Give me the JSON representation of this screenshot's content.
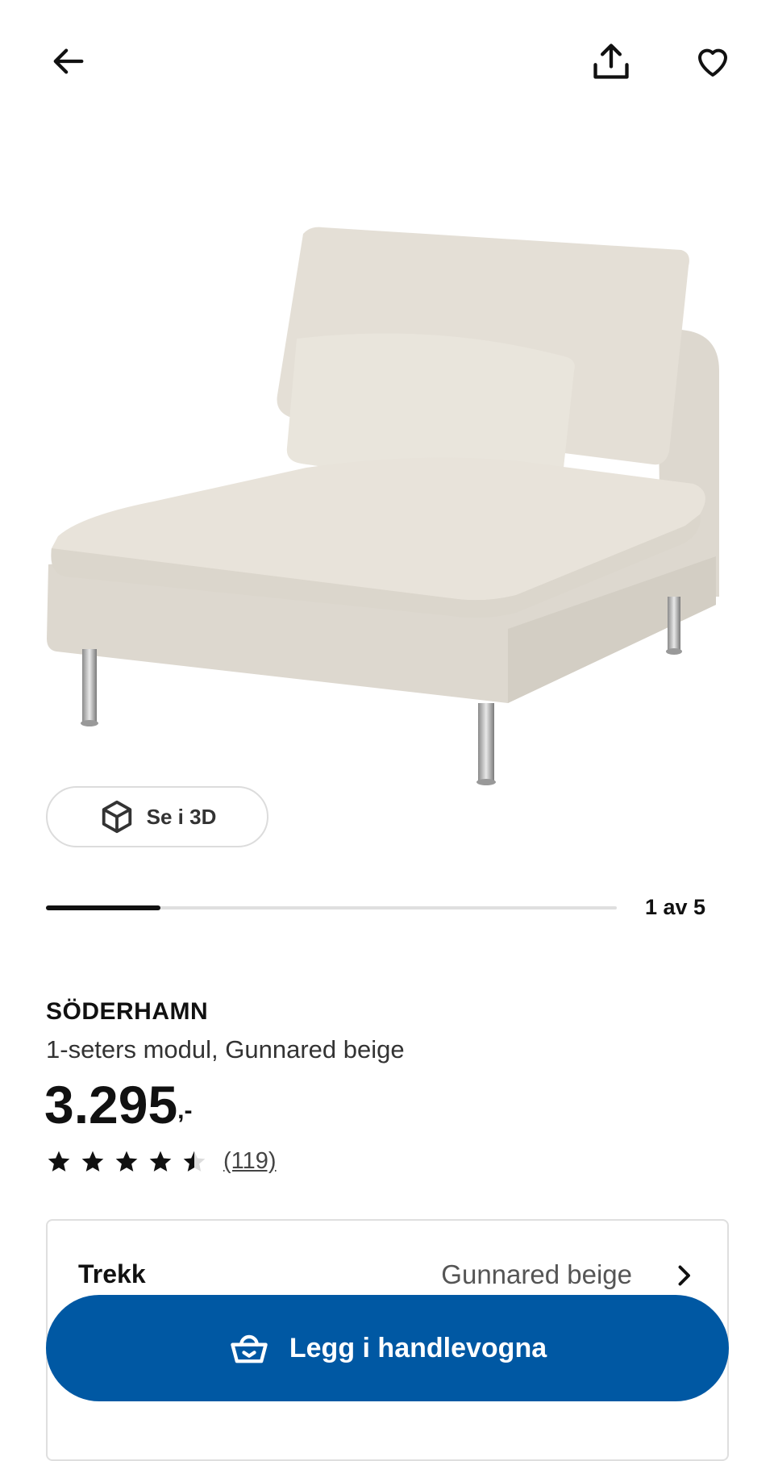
{
  "header": {
    "back_icon": "arrow-left-icon",
    "share_icon": "share-upload-icon",
    "favorite_icon": "heart-outline-icon"
  },
  "gallery": {
    "view_3d_label": "Se i 3D",
    "view_3d_icon": "cube-icon",
    "counter": "1 av 5",
    "progress": 0.2
  },
  "product": {
    "name": "SÖDERHAMN",
    "description": "1-seters modul, Gunnared beige",
    "price": "3.295",
    "price_suffix": ",-",
    "rating": 4.5,
    "review_count": "(119)"
  },
  "options": {
    "cover_label": "Trekk",
    "cover_value": "Gunnared beige"
  },
  "cart": {
    "label": "Legg i handlevogna",
    "icon": "shopping-basket-icon",
    "color": "#0058a3"
  }
}
